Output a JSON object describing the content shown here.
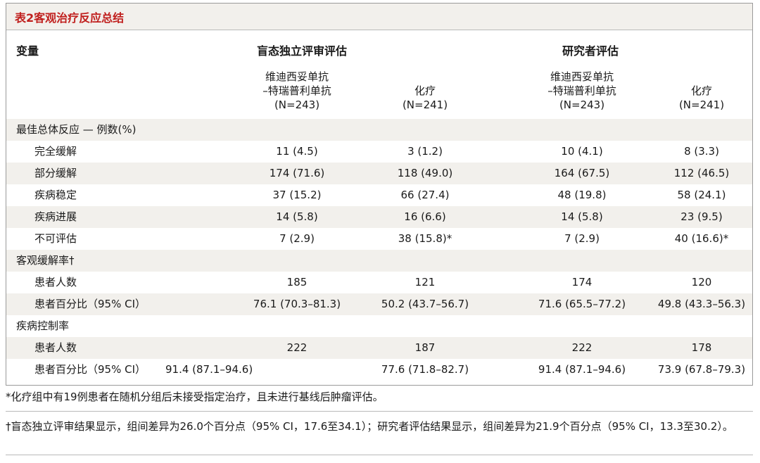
{
  "title": "表2客观治疗反应总结",
  "header": {
    "variable": "变量",
    "group1": "盲态独立评审评估",
    "group2": "研究者评估",
    "columns": [
      {
        "line1": "维迪西妥单抗",
        "line2": "–特瑞普利单抗",
        "line3": "(N=243)"
      },
      {
        "line1": "",
        "line2": "化疗",
        "line3": "(N=241)"
      },
      {
        "line1": "维迪西妥单抗",
        "line2": "–特瑞普利单抗",
        "line3": "(N=243)"
      },
      {
        "line1": "",
        "line2": "化疗",
        "line3": "(N=241)"
      }
    ]
  },
  "rows": [
    {
      "label": "最佳总体反应 — 例数(%)",
      "indent": false,
      "values": [
        "",
        "",
        "",
        ""
      ]
    },
    {
      "label": "完全缓解",
      "indent": true,
      "values": [
        "11 (4.5)",
        "3 (1.2)",
        "10 (4.1)",
        "8 (3.3)"
      ]
    },
    {
      "label": "部分缓解",
      "indent": true,
      "values": [
        "174 (71.6)",
        "118 (49.0)",
        "164 (67.5)",
        "112 (46.5)"
      ]
    },
    {
      "label": "疾病稳定",
      "indent": true,
      "values": [
        "37 (15.2)",
        "66 (27.4)",
        "48 (19.8)",
        "58 (24.1)"
      ]
    },
    {
      "label": "疾病进展",
      "indent": true,
      "values": [
        "14 (5.8)",
        "16 (6.6)",
        "14 (5.8)",
        "23 (9.5)"
      ]
    },
    {
      "label": "不可评估",
      "indent": true,
      "values": [
        "7 (2.9)",
        "38 (15.8)*",
        "7 (2.9)",
        "40 (16.6)*"
      ]
    },
    {
      "label": "客观缓解率†",
      "indent": false,
      "values": [
        "",
        "",
        "",
        ""
      ]
    },
    {
      "label": "患者人数",
      "indent": true,
      "values": [
        "185",
        "121",
        "174",
        "120"
      ]
    },
    {
      "label": "患者百分比（95% CI）",
      "indent": true,
      "values": [
        "76.1 (70.3–81.3)",
        "50.2 (43.7–56.7)",
        "71.6 (65.5–77.2)",
        "49.8 (43.3–56.3)"
      ]
    },
    {
      "label": "疾病控制率",
      "indent": false,
      "values": [
        "",
        "",
        "",
        ""
      ]
    },
    {
      "label": "患者人数",
      "indent": true,
      "values": [
        "222",
        "187",
        "222",
        "178"
      ]
    },
    {
      "label": "患者百分比（95% CI）",
      "indent": true,
      "values": [
        "91.4 (87.1–94.6)",
        "77.6 (71.8–82.7)",
        "91.4 (87.1–94.6)",
        "73.9 (67.8–79.3)"
      ]
    }
  ],
  "footnotes": {
    "star": "*化疗组中有19例患者在随机分组后未接受指定治疗，且未进行基线后肿瘤评估。",
    "dagger": "†盲态独立评审结果显示，组间差异为26.0个百分点（95% CI，17.6至34.1）；研究者评估结果显示，组间差异为21.9个百分点（95% CI，13.3至30.2）。"
  },
  "colors": {
    "title_red": "#c0201e",
    "shade": "#f2f0ec"
  }
}
